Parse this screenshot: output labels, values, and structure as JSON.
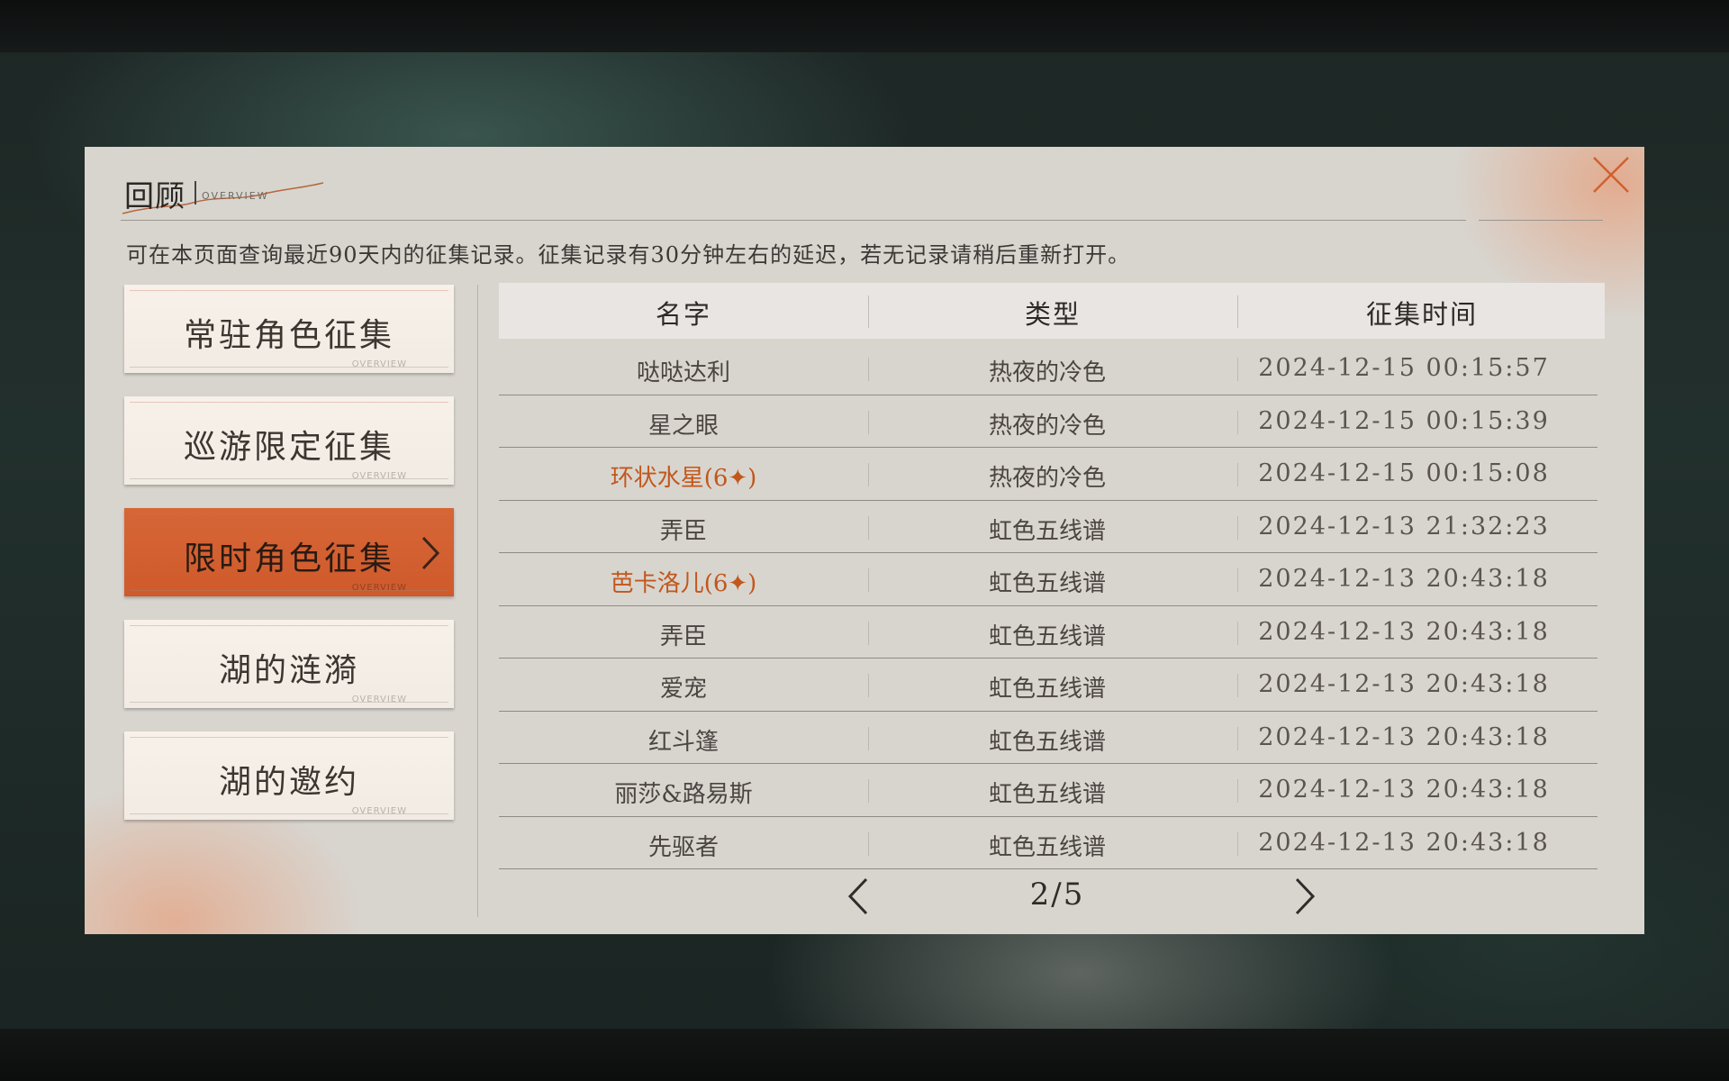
{
  "header": {
    "title": "回顾",
    "subtitle": "OVERVIEW",
    "notice": "可在本页面查询最近90天内的征集记录。征集记录有30分钟左右的延迟，若无记录请稍后重新打开。"
  },
  "sidebar": {
    "items": [
      {
        "label": "常驻角色征集",
        "tag": "OVERVIEW",
        "active": false
      },
      {
        "label": "巡游限定征集",
        "tag": "OVERVIEW",
        "active": false
      },
      {
        "label": "限时角色征集",
        "tag": "OVERVIEW",
        "active": true
      },
      {
        "label": "湖的涟漪",
        "tag": "OVERVIEW",
        "active": false
      },
      {
        "label": "湖的邀约",
        "tag": "OVERVIEW",
        "active": false
      }
    ]
  },
  "table": {
    "columns": [
      "名字",
      "类型",
      "征集时间"
    ],
    "rows": [
      {
        "name": "哒哒达利",
        "type": "热夜的冷色",
        "time": "2024-12-15 00:15:57",
        "highlight": false
      },
      {
        "name": "星之眼",
        "type": "热夜的冷色",
        "time": "2024-12-15 00:15:39",
        "highlight": false
      },
      {
        "name": "环状水星(6✦)",
        "type": "热夜的冷色",
        "time": "2024-12-15 00:15:08",
        "highlight": true
      },
      {
        "name": "弄臣",
        "type": "虹色五线谱",
        "time": "2024-12-13 21:32:23",
        "highlight": false
      },
      {
        "name": "芭卡洛儿(6✦)",
        "type": "虹色五线谱",
        "time": "2024-12-13 20:43:18",
        "highlight": true
      },
      {
        "name": "弄臣",
        "type": "虹色五线谱",
        "time": "2024-12-13 20:43:18",
        "highlight": false
      },
      {
        "name": "爱宠",
        "type": "虹色五线谱",
        "time": "2024-12-13 20:43:18",
        "highlight": false
      },
      {
        "name": "红斗篷",
        "type": "虹色五线谱",
        "time": "2024-12-13 20:43:18",
        "highlight": false
      },
      {
        "name": "丽莎&路易斯",
        "type": "虹色五线谱",
        "time": "2024-12-13 20:43:18",
        "highlight": false
      },
      {
        "name": "先驱者",
        "type": "虹色五线谱",
        "time": "2024-12-13 20:43:18",
        "highlight": false
      }
    ]
  },
  "pager": {
    "text": "2/5",
    "current": 2,
    "total": 5
  },
  "colors": {
    "accent": "#d0602f",
    "highlight_text": "#c2571c",
    "panel_bg": "#d8d5cf"
  },
  "icons": {
    "close": "close-icon",
    "prev": "chevron-left-icon",
    "next": "chevron-right-icon",
    "active_indicator": "chevron-right-icon"
  }
}
